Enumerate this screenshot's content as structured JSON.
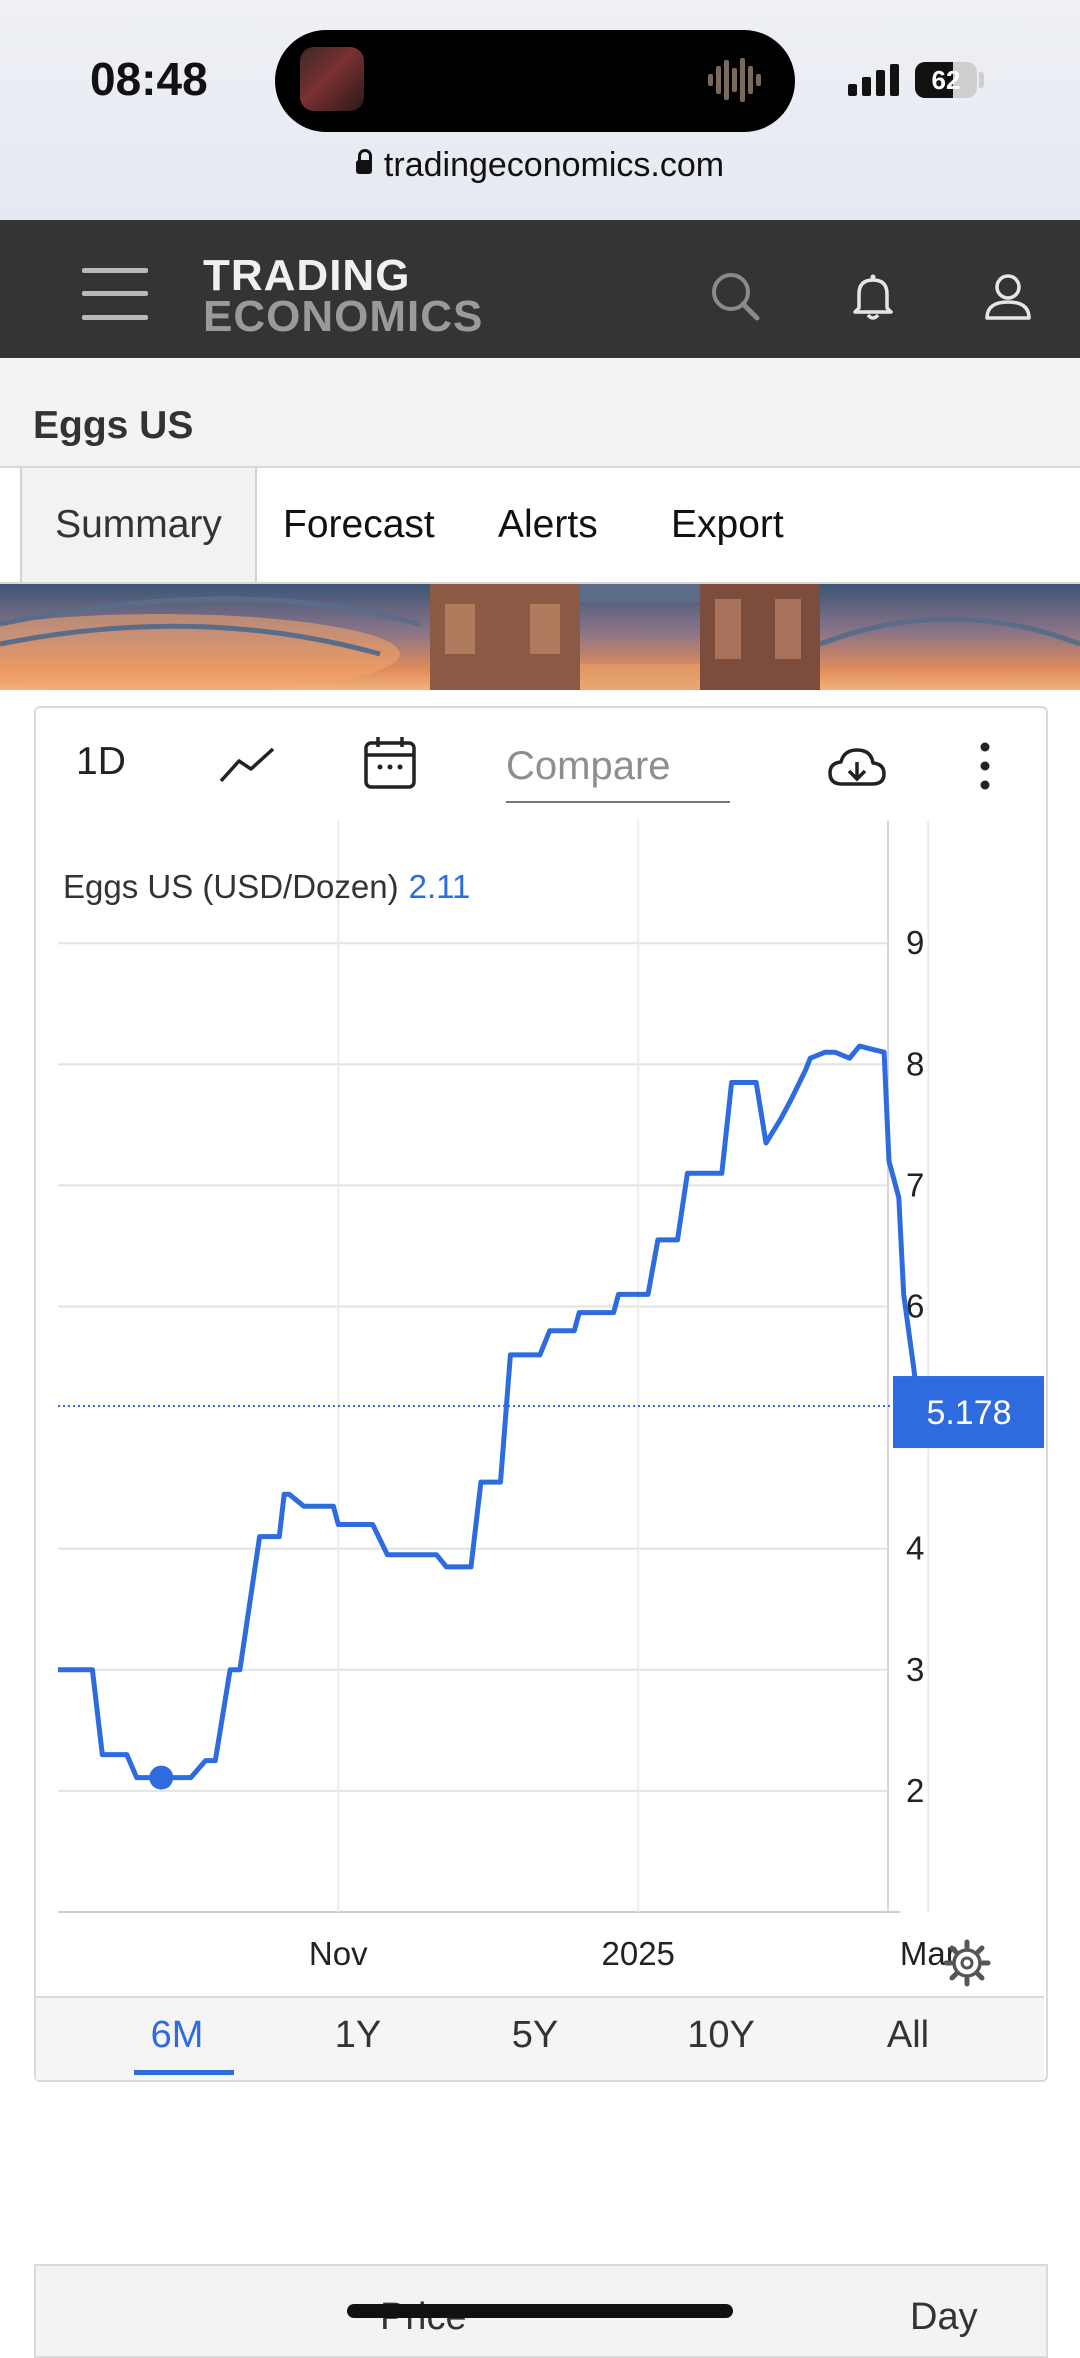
{
  "status_bar": {
    "time": "08:48",
    "battery": "62"
  },
  "browser": {
    "url": "tradingeconomics.com"
  },
  "header": {
    "logo_line1": "TRADING",
    "logo_line2": "ECONOMICS"
  },
  "page": {
    "title": "Eggs US"
  },
  "tabs": [
    {
      "label": "Summary",
      "active": true
    },
    {
      "label": "Forecast"
    },
    {
      "label": "Alerts"
    },
    {
      "label": "Export"
    }
  ],
  "toolbar": {
    "interval": "1D",
    "compare_placeholder": "Compare"
  },
  "chart_data": {
    "type": "line",
    "title": "Eggs US (USD/Dozen)",
    "current_value": "2.11",
    "last_value_label": "5.178",
    "x_ticks": [
      "Nov",
      "2025",
      "Mar"
    ],
    "y_ticks": [
      2,
      3,
      4,
      6,
      7,
      8,
      9
    ],
    "ylim": [
      1,
      9
    ],
    "grid": true,
    "series": [
      {
        "color": "#2d6bde",
        "x": [
          "2024-09-05",
          "2024-09-12",
          "2024-09-14",
          "2024-09-19",
          "2024-09-21",
          "2024-09-26",
          "2024-10-01",
          "2024-10-02",
          "2024-10-05",
          "2024-10-07",
          "2024-10-10",
          "2024-10-12",
          "2024-10-16",
          "2024-10-20",
          "2024-10-21",
          "2024-10-22",
          "2024-10-25",
          "2024-10-31",
          "2024-11-01",
          "2024-11-03",
          "2024-11-06",
          "2024-11-08",
          "2024-11-11",
          "2024-11-21",
          "2024-11-23",
          "2024-11-28",
          "2024-11-30",
          "2024-12-04",
          "2024-12-06",
          "2024-12-12",
          "2024-12-14",
          "2024-12-19",
          "2024-12-20",
          "2024-12-27",
          "2024-12-28",
          "2025-01-03",
          "2025-01-05",
          "2025-01-09",
          "2025-01-11",
          "2025-01-18",
          "2025-01-20",
          "2025-01-25",
          "2025-01-27",
          "2025-01-30",
          "2025-02-01",
          "2025-02-04",
          "2025-02-05",
          "2025-02-08",
          "2025-02-10",
          "2025-02-13",
          "2025-02-15",
          "2025-02-18",
          "2025-02-20",
          "2025-02-21",
          "2025-02-23",
          "2025-02-24",
          "2025-02-26",
          "2025-02-27",
          "2025-02-28",
          "2025-03-01",
          "2025-03-03",
          "2025-03-04",
          "2025-03-06",
          "2025-03-07",
          "2025-03-08",
          "2025-03-10"
        ],
        "y": [
          3.0,
          3.0,
          2.3,
          2.3,
          2.11,
          2.11,
          2.11,
          2.11,
          2.25,
          2.25,
          3.0,
          3.0,
          4.1,
          4.1,
          4.45,
          4.45,
          4.35,
          4.35,
          4.2,
          4.2,
          4.2,
          4.2,
          3.95,
          3.95,
          3.85,
          3.85,
          4.55,
          4.55,
          5.6,
          5.6,
          5.8,
          5.8,
          5.95,
          5.95,
          6.1,
          6.1,
          6.55,
          6.55,
          7.1,
          7.1,
          7.85,
          7.85,
          7.35,
          7.55,
          7.7,
          7.95,
          8.05,
          8.1,
          8.1,
          8.05,
          8.15,
          8.12,
          8.1,
          7.2,
          6.9,
          6.1,
          5.5,
          5.178,
          5.178,
          5.178,
          5.178,
          5.178,
          5.178,
          5.178,
          5.178,
          5.178
        ],
        "marker": {
          "x": "2024-09-26",
          "y": 2.11
        }
      }
    ]
  },
  "ranges": [
    {
      "label": "6M",
      "active": true
    },
    {
      "label": "1Y"
    },
    {
      "label": "5Y"
    },
    {
      "label": "10Y"
    },
    {
      "label": "All"
    }
  ],
  "table": {
    "col_price": "Price",
    "col_day": "Day"
  }
}
